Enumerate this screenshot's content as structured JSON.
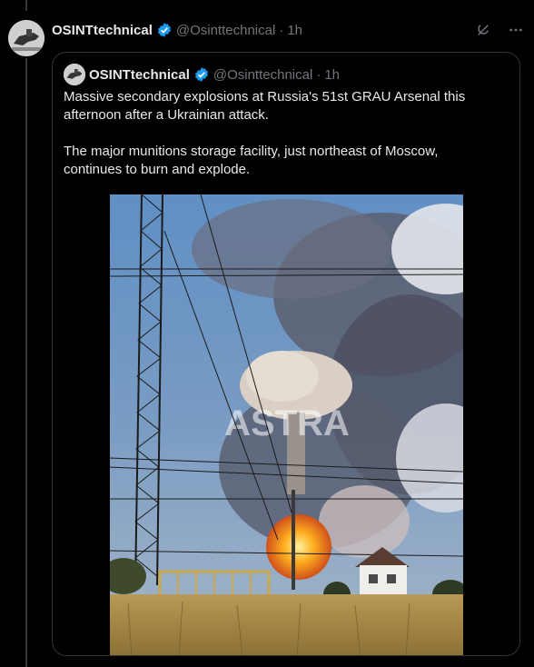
{
  "post": {
    "author_name": "OSINTtechnical",
    "handle": "@Osinttechnical",
    "separator": "·",
    "time": "1h",
    "actions": [
      "grok-icon",
      "more-icon"
    ]
  },
  "quoted": {
    "author_name": "OSINTtechnical",
    "handle": "@Osinttechnical",
    "separator": "·",
    "time": "1h",
    "text_p1": "Massive secondary explosions at Russia's 51st GRAU Arsenal this afternoon after a Ukrainian attack.",
    "text_p2": "The major munitions storage facility, just northeast of Moscow, continues to burn and explode.",
    "media_watermark": "ASTRA"
  },
  "colors": {
    "background": "#000000",
    "text": "#e7e9ea",
    "muted": "#71767b",
    "verified": "#1d9bf0",
    "border": "#2f3336"
  }
}
